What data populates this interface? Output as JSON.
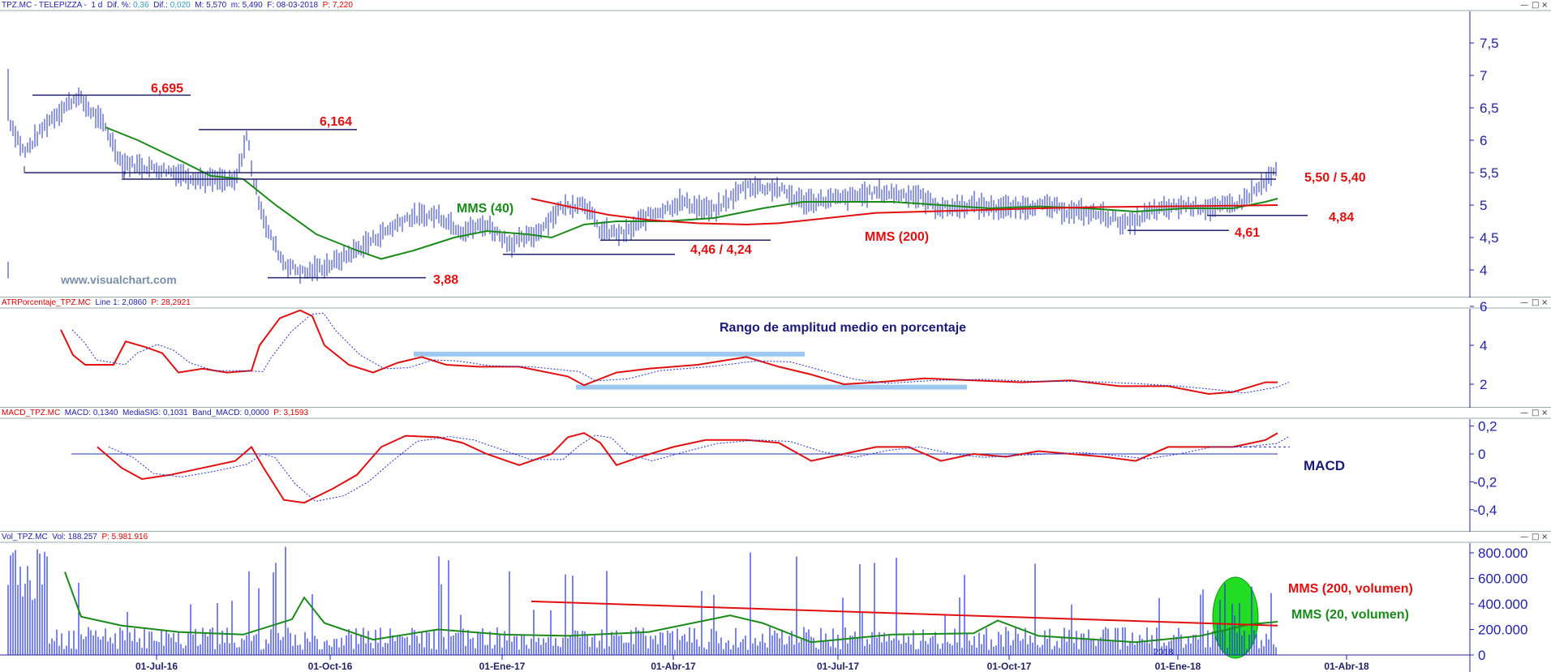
{
  "chart_data": [
    {
      "type": "line",
      "title": "TPZ.MC - TELEPIZZA - 1 d",
      "header": {
        "symbol": "TPZ.MC - TELEPIZZA -",
        "period": "1 d",
        "dif_pct_label": "Dif. %:",
        "dif_pct": "0,36",
        "dif_label": "Dif.:",
        "dif": "0,020",
        "max_label": "M:",
        "max": "5,570",
        "min_label": "m:",
        "min": "5,490",
        "date_label": "F:",
        "date": "08-03-2018",
        "price_label": "P:",
        "price": "7,220"
      },
      "ylim": [
        3.7,
        8.1
      ],
      "yticks": [
        "7,5",
        "7",
        "6,5",
        "6",
        "5,5",
        "5",
        "4,5",
        "4"
      ],
      "series": [
        {
          "name": "MMS (40)",
          "color": "#1a8a1a"
        },
        {
          "name": "MMS (200)",
          "color": "#e01010"
        }
      ],
      "levels": [
        {
          "label": "6,695",
          "value": 6.695
        },
        {
          "label": "6,164",
          "value": 6.164
        },
        {
          "label": "5,50 / 5,40",
          "values": [
            5.5,
            5.4
          ]
        },
        {
          "label": "4,84",
          "value": 4.84
        },
        {
          "label": "4,61",
          "value": 4.61
        },
        {
          "label": "4,46 / 4,24",
          "values": [
            4.46,
            4.24
          ]
        },
        {
          "label": "3,88",
          "value": 3.88
        }
      ],
      "watermark": "www.visualchart.com"
    },
    {
      "type": "line",
      "header": {
        "name": "ATRPorcentaje_TPZ.MC",
        "line_label": "Line 1:",
        "line": "2,0860",
        "p_label": "P:",
        "p": "28,2921"
      },
      "annotation": "Rango de amplitud medio en porcentaje",
      "yticks": [
        "6",
        "4",
        "2"
      ],
      "ylim": [
        1,
        6.2
      ],
      "channel": [
        3.5,
        1.8
      ]
    },
    {
      "type": "line",
      "header": {
        "name": "MACD_TPZ.MC",
        "macd_label": "MACD:",
        "macd": "0,1340",
        "sig_label": "MediaSIG:",
        "sig": "0,1031",
        "band_label": "Band_MACD:",
        "band": "0,0000",
        "p_label": "P:",
        "p": "3,1593"
      },
      "annotation": "MACD",
      "yticks": [
        "0,2",
        "0",
        "-0,2",
        "-0,4"
      ],
      "ylim": [
        -0.42,
        0.21
      ]
    },
    {
      "type": "bar",
      "header": {
        "name": "Vol_TPZ.MC",
        "vol_label": "Vol:",
        "vol": "188.257",
        "p_label": "P:",
        "p": "5.981.916"
      },
      "yticks": [
        "800.000",
        "600.000",
        "400.000",
        "200.000",
        "0"
      ],
      "ylim": [
        0,
        850000
      ],
      "series": [
        {
          "name": "MMS (200, volumen)",
          "color": "#e01010"
        },
        {
          "name": "MMS (20, volumen)",
          "color": "#1a8a1a"
        }
      ],
      "year_label": "2018"
    }
  ],
  "x_axis": {
    "ticks": [
      "01-Jul-16",
      "01-Oct-16",
      "01-Ene-17",
      "01-Abr-17",
      "01-Jul-17",
      "01-Oct-17",
      "01-Ene-18",
      "01-Abr-18"
    ]
  },
  "window_buttons": {
    "min": "—",
    "max": "□",
    "close": "×"
  }
}
